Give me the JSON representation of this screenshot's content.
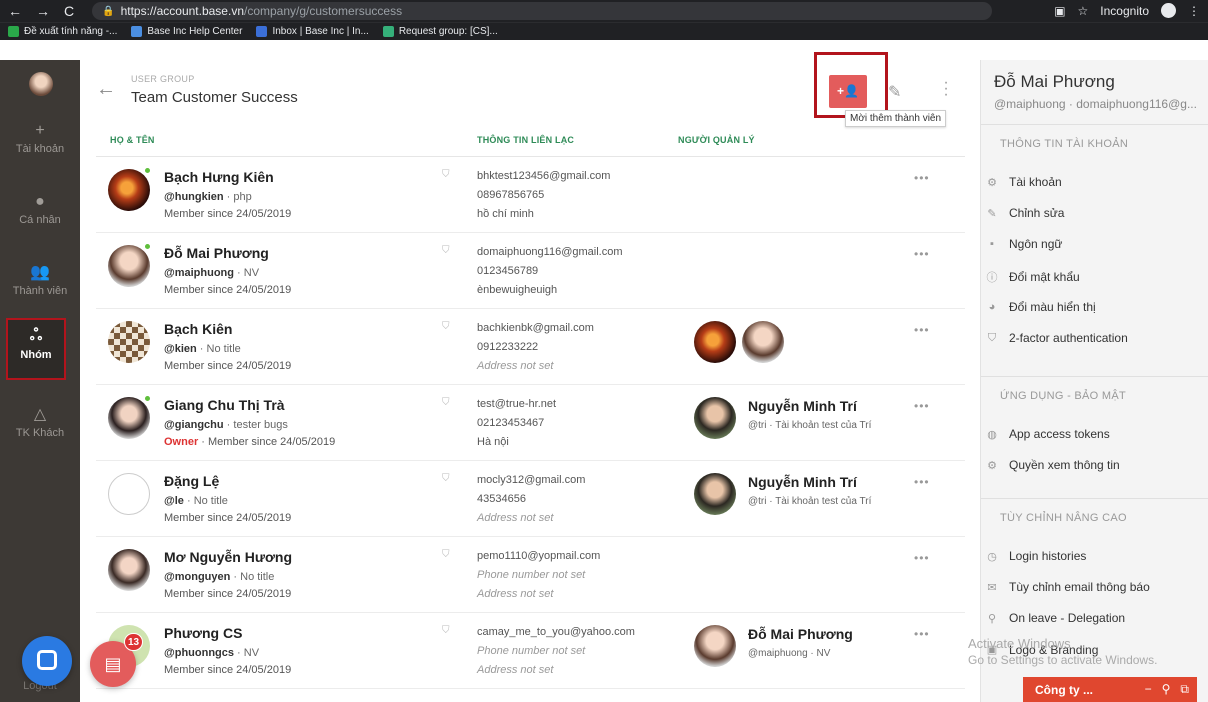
{
  "browser": {
    "url_host": "https://account.base.vn",
    "url_path": "/company/g/customersuccess",
    "incognito_label": "Incognito",
    "bookmarks": [
      {
        "label": "Đề xuất tính năng -...",
        "color": "#2aa84a"
      },
      {
        "label": "Base Inc Help Center",
        "color": "#4b8fe2"
      },
      {
        "label": "Inbox | Base Inc | In...",
        "color": "#3b6fd8"
      },
      {
        "label": "Request group: [CS]...",
        "color": "#35b07a"
      }
    ]
  },
  "leftnav": {
    "items": [
      {
        "label": "Tài khoản",
        "icon": "plus-icon"
      },
      {
        "label": "Cá nhân",
        "icon": "user-circle-icon"
      },
      {
        "label": "Thành viên",
        "icon": "users-icon"
      },
      {
        "label": "Nhóm",
        "icon": "group-icon",
        "active": true
      },
      {
        "label": "TK Khách",
        "icon": "triangle-icon"
      }
    ],
    "logout": "Logout"
  },
  "header": {
    "label": "USER GROUP",
    "title": "Team Customer Success",
    "add_button": "+👤",
    "tooltip": "Mời thêm thành viên"
  },
  "columns": {
    "name": "HỌ & TÊN",
    "contact": "THÔNG TIN LIÊN LẠC",
    "manager": "NGƯỜI QUẢN LÝ"
  },
  "members": [
    {
      "name": "Bạch Hưng Kiên",
      "handle": "@hungkien",
      "title": "php",
      "owner": "",
      "since": "Member since 24/05/2019",
      "email": "bhktest123456@gmail.com",
      "phone": "08967856765",
      "address": "hồ chí minh",
      "online": true
    },
    {
      "name": "Đỗ Mai Phương",
      "handle": "@maiphuong",
      "title": "NV",
      "owner": "",
      "since": "Member since 24/05/2019",
      "email": "domaiphuong116@gmail.com",
      "phone": "0123456789",
      "address": "ènbewuigheuigh",
      "online": true
    },
    {
      "name": "Bạch Kiên",
      "handle": "@kien",
      "title": "No title",
      "owner": "",
      "since": "Member since 24/05/2019",
      "email": "bachkienbk@gmail.com",
      "phone": "0912233222",
      "address": "Address not set",
      "online": false
    },
    {
      "name": "Giang Chu Thị Trà",
      "handle": "@giangchu",
      "title": "tester bugs",
      "owner": "Owner",
      "since": "Member since 24/05/2019",
      "email": "test@true-hr.net",
      "phone": "02123453467",
      "address": "Hà nội",
      "online": true,
      "manager_name": "Nguyễn Minh Trí",
      "manager_sub": "@tri · Tài khoản test của Trí"
    },
    {
      "name": "Đặng Lệ",
      "handle": "@le",
      "title": "No title",
      "owner": "",
      "since": "Member since 24/05/2019",
      "email": "mocly312@gmail.com",
      "phone": "43534656",
      "address": "Address not set",
      "online": false,
      "manager_name": "Nguyễn Minh Trí",
      "manager_sub": "@tri · Tài khoản test của Trí"
    },
    {
      "name": "Mơ Nguyễn Hương",
      "handle": "@monguyen",
      "title": "No title",
      "owner": "",
      "since": "Member since 24/05/2019",
      "email": "pemo1110@yopmail.com",
      "phone": "Phone number not set",
      "address": "Address not set",
      "online": false
    },
    {
      "name": "Phương CS",
      "handle": "@phuonngcs",
      "title": "NV",
      "owner": "",
      "since": "Member since 24/05/2019",
      "email": "camay_me_to_you@yahoo.com",
      "phone": "Phone number not set",
      "address": "Address not set",
      "online": false,
      "manager_name": "Đỗ Mai Phương",
      "manager_sub": "@maiphuong · NV"
    }
  ],
  "profile": {
    "name": "Đỗ Mai Phương",
    "handle": "@maiphuong · domaiphuong116@g...",
    "sections": [
      {
        "title": "THÔNG TIN TÀI KHOẢN",
        "items": [
          "Tài khoản",
          "Chỉnh sửa",
          "Ngôn ngữ",
          "Đổi mật khẩu",
          "Đổi màu hiển thị",
          "2-factor authentication"
        ]
      },
      {
        "title": "ỨNG DỤNG - BẢO MẬT",
        "items": [
          "App access tokens",
          "Quyền xem thông tin"
        ]
      },
      {
        "title": "TÙY CHỈNH NÂNG CAO",
        "items": [
          "Login histories",
          "Tùy chỉnh email thông báo",
          "On leave - Delegation",
          "Logo & Branding"
        ]
      }
    ]
  },
  "watermark": {
    "line1": "Activate Windows",
    "line2": "Go to Settings to activate Windows."
  },
  "company_bar": {
    "label": "Công ty ..."
  },
  "task_badge": "13"
}
